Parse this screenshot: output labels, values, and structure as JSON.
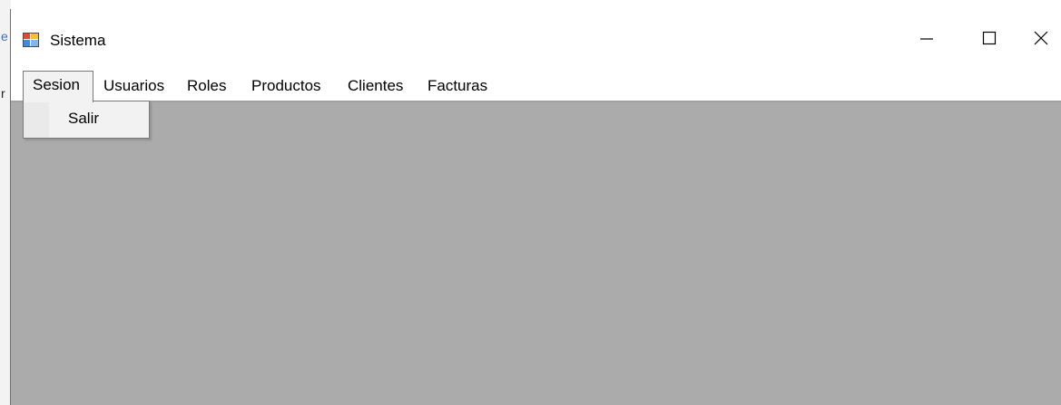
{
  "window": {
    "title": "Sistema",
    "controls": {
      "minimize_icon": "minimize-icon",
      "maximize_icon": "maximize-icon",
      "close_icon": "close-icon"
    }
  },
  "menubar": {
    "items": [
      {
        "label": "Sesion",
        "open": true
      },
      {
        "label": "Usuarios"
      },
      {
        "label": "Roles"
      },
      {
        "label": "Productos"
      },
      {
        "label": "Clientes"
      },
      {
        "label": "Facturas"
      }
    ]
  },
  "dropdown": {
    "parent": "Sesion",
    "items": [
      {
        "label": "Salir"
      }
    ]
  },
  "colors": {
    "client_area": "#ababab",
    "menu_open_bg": "#f2f2f2",
    "menu_border": "#7a7a7a"
  }
}
